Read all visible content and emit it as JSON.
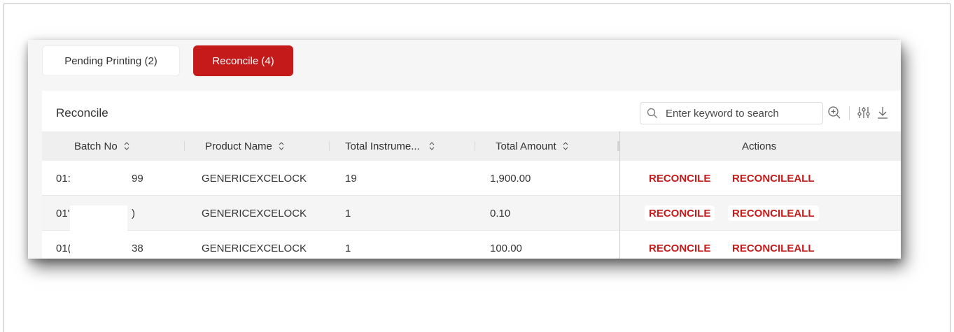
{
  "tabs": [
    {
      "label": "Pending Printing (2)",
      "active": false
    },
    {
      "label": "Reconcile (4)",
      "active": true
    }
  ],
  "card": {
    "title": "Reconcile",
    "search_placeholder": "Enter keyword to search"
  },
  "table": {
    "columns": [
      "Batch No",
      "Product Name",
      "Total Instrume...",
      "Total Amount",
      "Actions"
    ],
    "rows": [
      {
        "batch_prefix": "01:",
        "batch_suffix": "99",
        "product": "GENERICEXCELOCK",
        "instruments": "19",
        "amount": "1,900.00",
        "action1": "RECONCILE",
        "action2": "RECONCILEALL"
      },
      {
        "batch_prefix": "01'",
        "batch_suffix": ")",
        "product": "GENERICEXCELOCK",
        "instruments": "1",
        "amount": "0.10",
        "action1": "RECONCILE",
        "action2": "RECONCILEALL"
      },
      {
        "batch_prefix": "01(",
        "batch_suffix": "38",
        "product": "GENERICEXCELOCK",
        "instruments": "1",
        "amount": "100.00",
        "action1": "RECONCILE",
        "action2": "RECONCILEALL"
      }
    ]
  },
  "icons": {
    "search": "search-icon",
    "zoom": "zoom-in-icon",
    "filter": "filter-sliders-icon",
    "download": "download-icon",
    "sort": "sort-icon"
  },
  "colors": {
    "accent": "#c41a1a",
    "header_bg": "#efefef"
  }
}
